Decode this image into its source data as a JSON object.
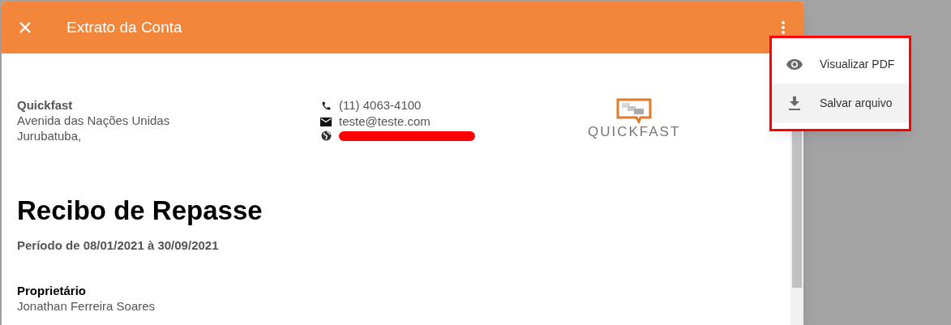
{
  "dialog": {
    "title": "Extrato da Conta"
  },
  "company": {
    "name": "Quickfast",
    "address_lines": [
      "Avenida das Nações Unidas",
      "Jurubatuba,"
    ]
  },
  "contacts": [
    {
      "kind": "phone",
      "text": "(11) 4063-4100",
      "redacted": false
    },
    {
      "kind": "email",
      "text": "teste@teste.com",
      "redacted": false
    },
    {
      "kind": "web",
      "redacted": true
    }
  ],
  "logo": {
    "text": "QUICKFAST"
  },
  "document": {
    "title": "Recibo de Repasse",
    "period": "Período de 08/01/2021 à 30/09/2021",
    "owner_label": "Proprietário",
    "owner_name": "Jonathan Ferreira Soares"
  },
  "menu": {
    "highlighted_border": true,
    "items": [
      {
        "kind": "view",
        "label": "Visualizar PDF",
        "selected": false
      },
      {
        "kind": "download",
        "label": "Salvar arquivo",
        "selected": true
      }
    ]
  }
}
